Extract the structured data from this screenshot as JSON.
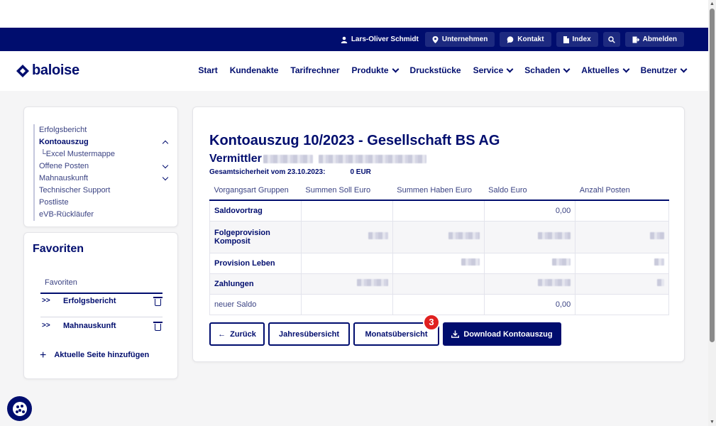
{
  "topbar": {
    "user": "Lars-Oliver Schmidt",
    "buttons": [
      "Unternehmen",
      "Kontakt",
      "Index",
      "Abmelden"
    ]
  },
  "header": {
    "logo": "baloise",
    "nav": [
      "Start",
      "Kundenakte",
      "Tarifrechner",
      "Produkte",
      "Druckstücke",
      "Service",
      "Schaden",
      "Aktuelles",
      "Benutzer"
    ]
  },
  "sidebar": {
    "items": [
      "Erfolgsbericht",
      "Kontoauszug",
      "Excel Mustermappe",
      "Offene Posten",
      "Mahnauskunft",
      "Technischer Support",
      "Postliste",
      "eVB-Rückläufer"
    ]
  },
  "favorites": {
    "title": "Favoriten",
    "subtitle": "Favoriten",
    "items": [
      "Erfolgsbericht",
      "Mahnauskunft"
    ],
    "add_label": "Aktuelle Seite hinzufügen"
  },
  "main": {
    "title": "Kontoauszug 10/2023 - Gesellschaft BS AG",
    "subtitle": "Vermittler",
    "info_label": "Gesamtsicherheit vom 23.10.2023:",
    "info_value": "0 EUR",
    "table": {
      "headers": [
        "Vorgangsart Gruppen",
        "Summen Soll Euro",
        "Summen Haben Euro",
        "Saldo Euro",
        "Anzahl Posten"
      ],
      "rows": [
        {
          "name": "Saldovortrag",
          "saldo": "0,00"
        },
        {
          "name": "Folgeprovision Komposit",
          "saldo": ""
        },
        {
          "name": "Provision Leben",
          "saldo": ""
        },
        {
          "name": "Zahlungen",
          "saldo": ""
        },
        {
          "name": "neuer Saldo",
          "saldo": "0,00"
        }
      ]
    },
    "buttons": {
      "back": "Zurück",
      "yearly": "Jahresübersicht",
      "monthly": "Monatsübersicht",
      "download": "Download Kontoauszug"
    },
    "badge": "3"
  }
}
